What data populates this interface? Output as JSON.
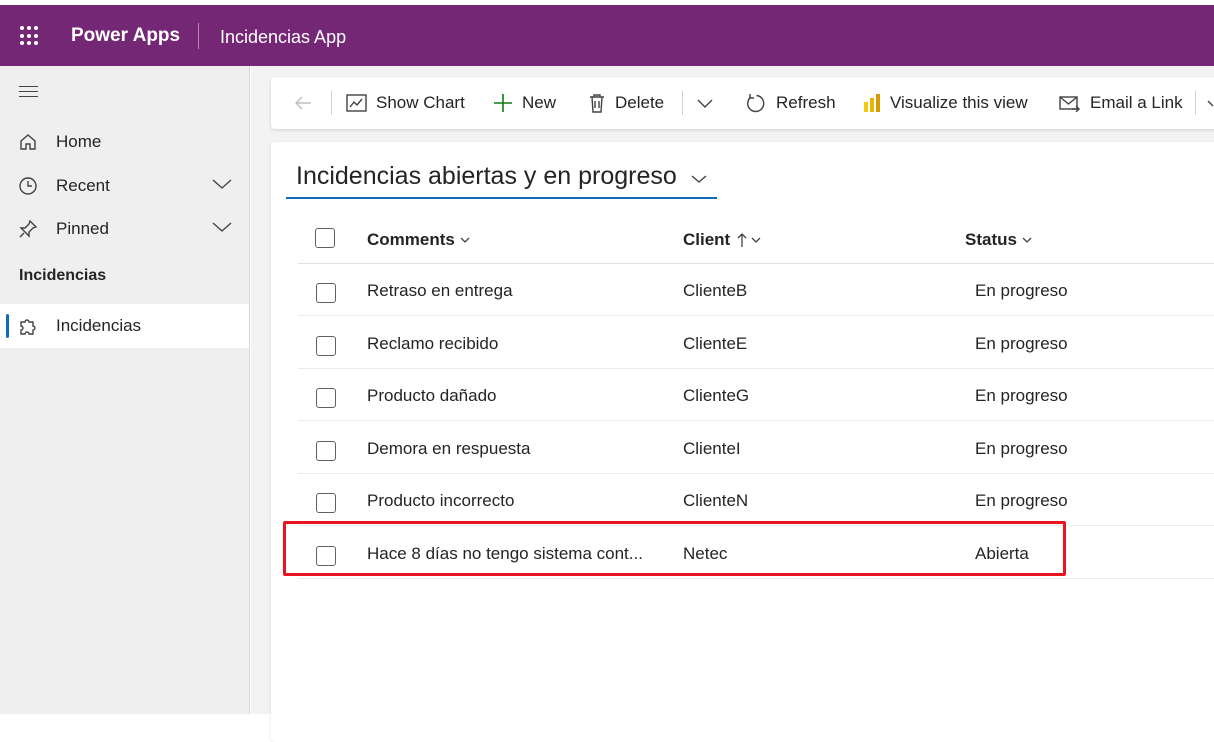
{
  "header": {
    "app_name": "Power Apps",
    "app_title": "Incidencias App",
    "brand_color": "#742774",
    "waffle_icon": "waffle-icon"
  },
  "sidebar": {
    "menu_icon": "hamburger-icon",
    "items": [
      {
        "label": "Home",
        "icon": "home-icon"
      },
      {
        "label": "Recent",
        "icon": "clock-icon"
      },
      {
        "label": "Pinned",
        "icon": "pin-icon"
      }
    ],
    "group_label": "Incidencias",
    "group_items": [
      {
        "label": "Incidencias",
        "icon": "puzzle-icon",
        "selected": true
      }
    ]
  },
  "commandbar": {
    "back_icon": "back-arrow-icon",
    "show_chart": "Show Chart",
    "new": "New",
    "delete": "Delete",
    "refresh": "Refresh",
    "visualize": "Visualize this view",
    "email_link": "Email a Link"
  },
  "view": {
    "title": "Incidencias abiertas y en progreso",
    "columns": [
      "Comments",
      "Client",
      "Status"
    ],
    "rows": [
      {
        "comments": "Retraso en entrega",
        "client": "ClienteB",
        "status": "En progreso"
      },
      {
        "comments": "Reclamo recibido",
        "client": "ClienteE",
        "status": "En progreso"
      },
      {
        "comments": "Producto dañado",
        "client": "ClienteG",
        "status": "En progreso"
      },
      {
        "comments": "Demora en respuesta",
        "client": "ClienteI",
        "status": "En progreso"
      },
      {
        "comments": "Producto incorrecto",
        "client": "ClienteN",
        "status": "En progreso"
      },
      {
        "comments": "Hace 8 días no tengo sistema cont...",
        "client": "Netec",
        "status": "Abierta"
      }
    ],
    "accent_color": "#0f6cbd",
    "highlight_color": "#e8141f"
  }
}
